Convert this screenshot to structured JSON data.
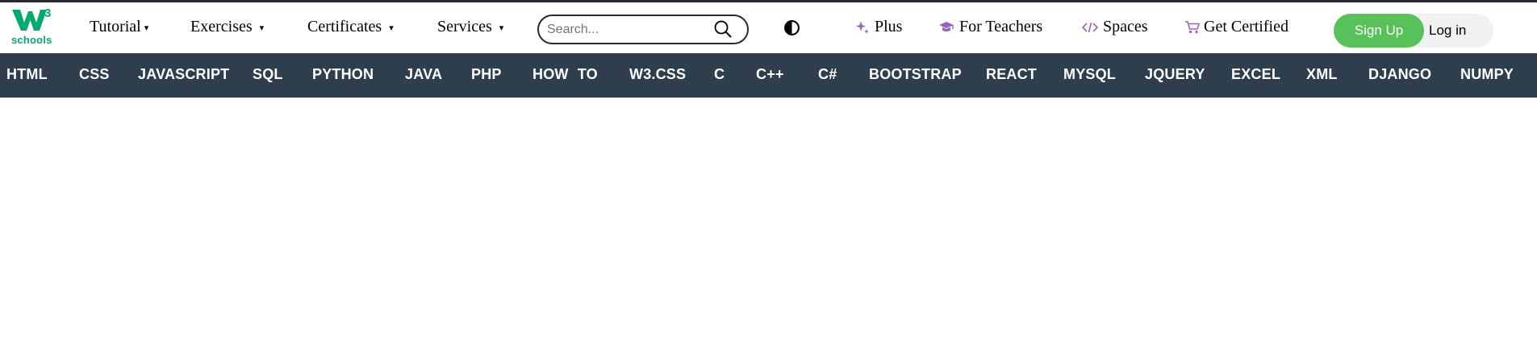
{
  "logo": {
    "superscript": "3",
    "word": "schools",
    "brand_color": "#04aa6d"
  },
  "top_menu": [
    {
      "label": "Tutorial",
      "caret": "▾"
    },
    {
      "label": "Exercises",
      "caret": "▾"
    },
    {
      "label": "Certificates",
      "caret": "▾"
    },
    {
      "label": "Services",
      "caret": "▾"
    }
  ],
  "search": {
    "placeholder": "Search...",
    "icon": "search-icon"
  },
  "theme_toggle": {
    "icon": "contrast-icon"
  },
  "top_links": [
    {
      "label": "Plus",
      "icon": "sparkle-icon"
    },
    {
      "label": "For Teachers",
      "icon": "graduation-cap-icon"
    },
    {
      "label": "Spaces",
      "icon": "code-icon"
    },
    {
      "label": "Get Certified",
      "icon": "cart-icon"
    }
  ],
  "auth": {
    "signup_label": "Sign Up",
    "login_label": "Log in",
    "signup_color": "#59c159"
  },
  "nav_items": [
    "HTML",
    "CSS",
    "JAVASCRIPT",
    "SQL",
    "PYTHON",
    "JAVA",
    "PHP",
    "HOW TO",
    "W3.CSS",
    "C",
    "C++",
    "C#",
    "BOOTSTRAP",
    "REACT",
    "MYSQL",
    "JQUERY",
    "EXCEL",
    "XML",
    "DJANGO",
    "NUMPY"
  ],
  "colors": {
    "nav_bg": "#2f3e4c",
    "accent_purple": "#9763b7"
  }
}
